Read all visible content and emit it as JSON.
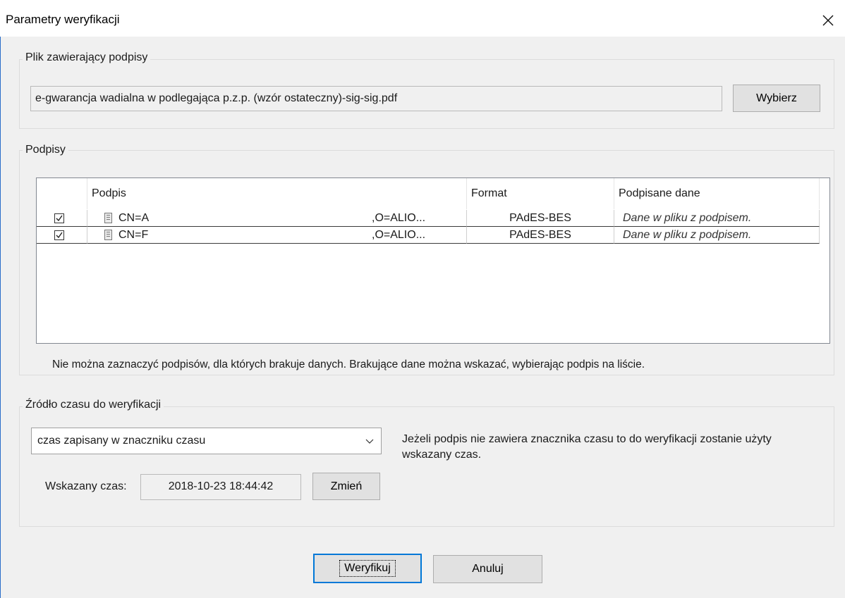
{
  "window": {
    "title": "Parametry weryfikacji",
    "close_icon": "close-icon"
  },
  "file_group": {
    "legend": "Plik zawierający podpisy",
    "path_value": "e-gwarancja wadialna w podlegająca p.z.p. (wzór ostateczny)-sig-sig.pdf",
    "browse_label": "Wybierz"
  },
  "signatures_group": {
    "legend": "Podpisy",
    "columns": [
      "",
      "Podpis",
      "Format",
      "Podpisane dane"
    ],
    "rows": [
      {
        "checked": true,
        "podpis_left": "CN=A",
        "podpis_right": ",O=ALIO...",
        "format": "PAdES-BES",
        "data": "Dane w pliku z podpisem."
      },
      {
        "checked": true,
        "podpis_left": "CN=F",
        "podpis_right": ",O=ALIO...",
        "format": "PAdES-BES",
        "data": "Dane w pliku z podpisem."
      }
    ],
    "note": "Nie można zaznaczyć podpisów, dla których brakuje danych. Brakujące dane można wskazać, wybierając podpis na liście."
  },
  "time_group": {
    "legend": "Źródło czasu do weryfikacji",
    "source_selected": "czas zapisany w znaczniku czasu",
    "info": "Jeżeli podpis nie zawiera znacznika czasu to do weryfikacji zostanie użyty wskazany czas.",
    "time_label": "Wskazany czas:",
    "time_value": "2018-10-23 18:44:42",
    "change_label": "Zmień"
  },
  "actions": {
    "verify_label": "Weryfikuj",
    "cancel_label": "Anuluj"
  }
}
